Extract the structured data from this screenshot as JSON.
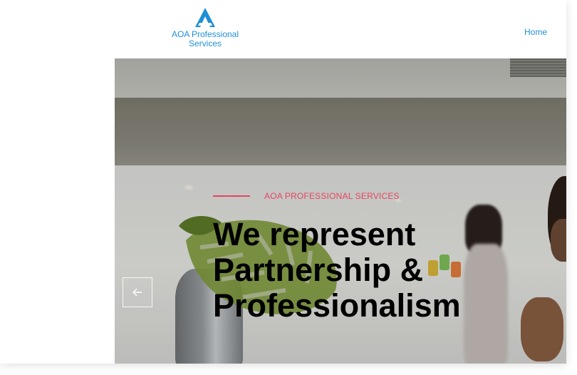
{
  "header": {
    "logo_text_line1": "AOA Professional",
    "logo_text_line2": "Services",
    "logo_icon": "aoa-logo-icon",
    "nav": {
      "home_label": "Home"
    }
  },
  "hero": {
    "eyebrow": "AOA PROFESSIONAL SERVICES",
    "headline_lines": [
      "We represent",
      "Partnership &",
      "Professionalism"
    ],
    "prev_icon": "arrow-left-icon"
  },
  "colors": {
    "brand_blue": "#1f8fd6",
    "accent_red": "#e5455f",
    "headline": "#000000"
  }
}
